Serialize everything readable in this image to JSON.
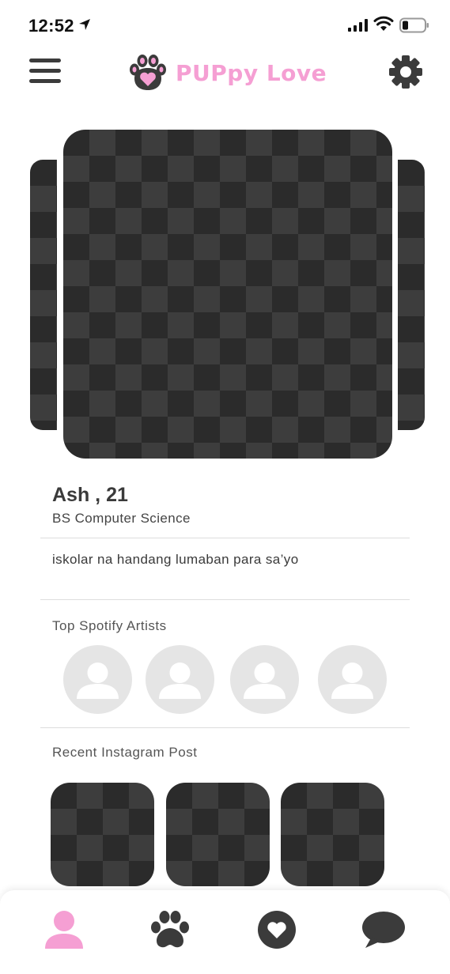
{
  "status_bar": {
    "time": "12:52"
  },
  "header": {
    "app_title": "PUPpy Love",
    "brand_color": "#f59fd3",
    "icons": [
      "hamburger-menu-icon",
      "paw-heart-logo-icon",
      "gear-icon"
    ]
  },
  "profile": {
    "name_age": "Ash , 21",
    "course": "BS Computer Science",
    "bio": "iskolar na handang lumaban para sa’yo"
  },
  "sections": {
    "spotify_title": "Top Spotify Artists",
    "instagram_title": "Recent Instagram Post"
  },
  "spotify_artists": [
    {
      "icon": "default-avatar-icon"
    },
    {
      "icon": "default-avatar-icon"
    },
    {
      "icon": "default-avatar-icon"
    },
    {
      "icon": "default-avatar-icon"
    }
  ],
  "tabbar": {
    "active_color": "#f59fd3",
    "inactive_color": "#3b3b3b",
    "tabs": [
      {
        "icon": "profile-icon",
        "active": true
      },
      {
        "icon": "paw-icon",
        "active": false
      },
      {
        "icon": "heart-icon",
        "active": false
      },
      {
        "icon": "chat-bubble-icon",
        "active": false
      }
    ]
  }
}
